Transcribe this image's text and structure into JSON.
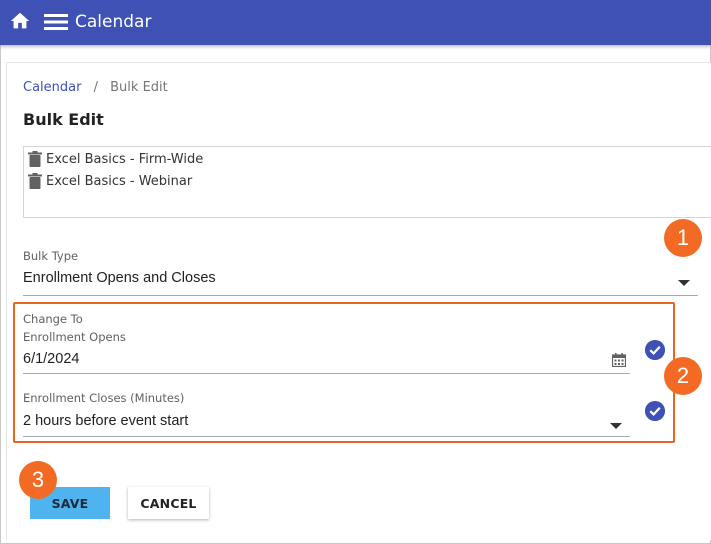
{
  "app": {
    "title": "Calendar"
  },
  "breadcrumb": {
    "parent": "Calendar",
    "separator": "/",
    "current": "Bulk Edit"
  },
  "page": {
    "title": "Bulk Edit"
  },
  "selected_items": [
    {
      "label": "Excel Basics - Firm-Wide"
    },
    {
      "label": "Excel Basics - Webinar"
    }
  ],
  "bulk_type": {
    "label": "Bulk Type",
    "value": "Enrollment Opens and Closes"
  },
  "change_to": {
    "section_label": "Change To",
    "enrollment_opens": {
      "label": "Enrollment Opens",
      "value": "6/1/2024"
    },
    "enrollment_closes": {
      "label": "Enrollment Closes (Minutes)",
      "value": "2 hours before event start"
    }
  },
  "callouts": {
    "one": "1",
    "two": "2",
    "three": "3"
  },
  "buttons": {
    "save": "SAVE",
    "cancel": "CANCEL"
  },
  "icons": {
    "home": "home-icon",
    "menu": "hamburger-menu-icon",
    "trash": "trash-icon",
    "calendar": "calendar-icon",
    "check": "check-circle-icon",
    "dropdown": "dropdown-arrow-icon"
  },
  "colors": {
    "appbar": "#3f51b5",
    "link": "#3f51b5",
    "callout": "#f26a23",
    "highlight": "#e8651f",
    "save_button": "#4fb3f0"
  }
}
